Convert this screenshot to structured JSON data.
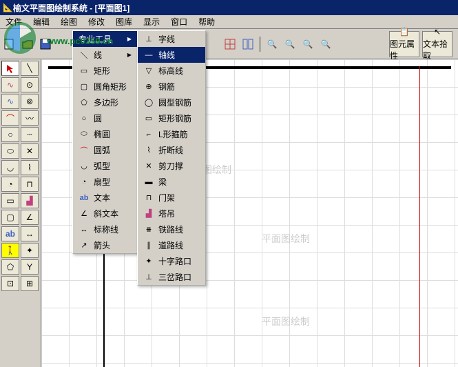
{
  "titlebar": {
    "text": "榆文平面图绘制系统 - [平面图1]"
  },
  "menubar": [
    "文件",
    "编辑",
    "绘图",
    "修改",
    "图库",
    "显示",
    "窗口",
    "帮助"
  ],
  "toolbar_right": {
    "btn1": "图元属性",
    "btn2": "文本拾取"
  },
  "menu_l1": {
    "header": "专业工具",
    "items": [
      "线",
      "矩形",
      "圆角矩形",
      "多边形",
      "圆",
      "椭圆",
      "圆弧",
      "弧型",
      "扇型",
      "文本",
      "斜文本",
      "标称线",
      "箭头"
    ]
  },
  "menu_l2": {
    "items": [
      "字线",
      "轴线",
      "标高线",
      "钢筋",
      "圆型钢筋",
      "矩形钢筋",
      "L形箍筋",
      "折断线",
      "剪刀撑",
      "梁",
      "门架",
      "塔吊",
      "铁路线",
      "道路线",
      "十字路口",
      "三岔路口"
    ],
    "highlighted": 1
  },
  "canvas": {
    "watermarks": [
      "面图绘制",
      "平面图绘制",
      "平面图绘制"
    ]
  },
  "watermark_url": "www.pc0359.cn"
}
